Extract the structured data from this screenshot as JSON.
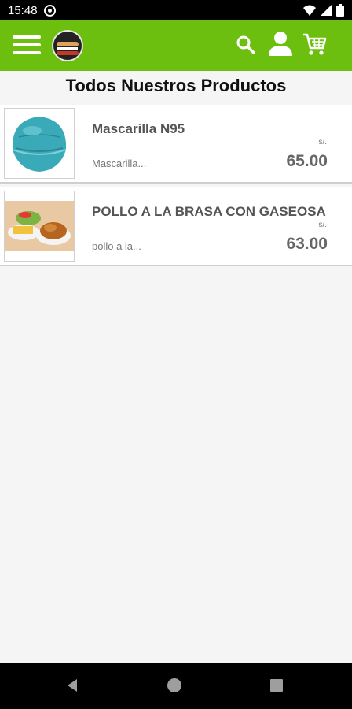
{
  "status": {
    "time": "15:48"
  },
  "app_bar": {
    "colors": {
      "brand_green": "#6cbf0e"
    },
    "icons": [
      "menu-icon",
      "logo",
      "search-icon",
      "user-icon",
      "cart-icon"
    ]
  },
  "main": {
    "title": "Todos Nuestros Productos",
    "products": [
      {
        "name": "Mascarilla N95",
        "description": "Mascarilla...",
        "currency": "s/.",
        "price": "65.00"
      },
      {
        "name": "POLLO A LA BRASA CON GASEOSA",
        "description": "pollo a la...",
        "currency": "s/.",
        "price": "63.00"
      }
    ]
  },
  "nav": {
    "icons": [
      "back-icon",
      "home-icon",
      "recents-icon"
    ]
  }
}
